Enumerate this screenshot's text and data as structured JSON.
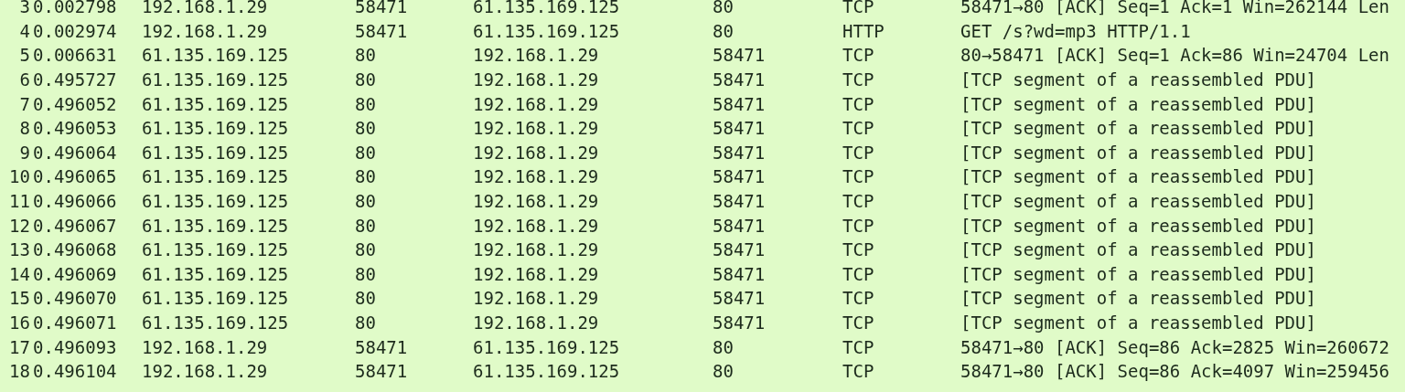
{
  "packet_list": {
    "rows": [
      {
        "no": "3",
        "time": "0.002798",
        "source": "192.168.1.29",
        "src_port": "58471",
        "destination": "61.135.169.125",
        "dst_port": "80",
        "protocol": "TCP",
        "info": "58471→80 [ACK] Seq=1 Ack=1 Win=262144 Len"
      },
      {
        "no": "4",
        "time": "0.002974",
        "source": "192.168.1.29",
        "src_port": "58471",
        "destination": "61.135.169.125",
        "dst_port": "80",
        "protocol": "HTTP",
        "info": "GET /s?wd=mp3 HTTP/1.1"
      },
      {
        "no": "5",
        "time": "0.006631",
        "source": "61.135.169.125",
        "src_port": "80",
        "destination": "192.168.1.29",
        "dst_port": "58471",
        "protocol": "TCP",
        "info": "80→58471 [ACK] Seq=1 Ack=86 Win=24704 Len"
      },
      {
        "no": "6",
        "time": "0.495727",
        "source": "61.135.169.125",
        "src_port": "80",
        "destination": "192.168.1.29",
        "dst_port": "58471",
        "protocol": "TCP",
        "info": "[TCP segment of a reassembled PDU]"
      },
      {
        "no": "7",
        "time": "0.496052",
        "source": "61.135.169.125",
        "src_port": "80",
        "destination": "192.168.1.29",
        "dst_port": "58471",
        "protocol": "TCP",
        "info": "[TCP segment of a reassembled PDU]"
      },
      {
        "no": "8",
        "time": "0.496053",
        "source": "61.135.169.125",
        "src_port": "80",
        "destination": "192.168.1.29",
        "dst_port": "58471",
        "protocol": "TCP",
        "info": "[TCP segment of a reassembled PDU]"
      },
      {
        "no": "9",
        "time": "0.496064",
        "source": "61.135.169.125",
        "src_port": "80",
        "destination": "192.168.1.29",
        "dst_port": "58471",
        "protocol": "TCP",
        "info": "[TCP segment of a reassembled PDU]"
      },
      {
        "no": "10",
        "time": "0.496065",
        "source": "61.135.169.125",
        "src_port": "80",
        "destination": "192.168.1.29",
        "dst_port": "58471",
        "protocol": "TCP",
        "info": "[TCP segment of a reassembled PDU]"
      },
      {
        "no": "11",
        "time": "0.496066",
        "source": "61.135.169.125",
        "src_port": "80",
        "destination": "192.168.1.29",
        "dst_port": "58471",
        "protocol": "TCP",
        "info": "[TCP segment of a reassembled PDU]"
      },
      {
        "no": "12",
        "time": "0.496067",
        "source": "61.135.169.125",
        "src_port": "80",
        "destination": "192.168.1.29",
        "dst_port": "58471",
        "protocol": "TCP",
        "info": "[TCP segment of a reassembled PDU]"
      },
      {
        "no": "13",
        "time": "0.496068",
        "source": "61.135.169.125",
        "src_port": "80",
        "destination": "192.168.1.29",
        "dst_port": "58471",
        "protocol": "TCP",
        "info": "[TCP segment of a reassembled PDU]"
      },
      {
        "no": "14",
        "time": "0.496069",
        "source": "61.135.169.125",
        "src_port": "80",
        "destination": "192.168.1.29",
        "dst_port": "58471",
        "protocol": "TCP",
        "info": "[TCP segment of a reassembled PDU]"
      },
      {
        "no": "15",
        "time": "0.496070",
        "source": "61.135.169.125",
        "src_port": "80",
        "destination": "192.168.1.29",
        "dst_port": "58471",
        "protocol": "TCP",
        "info": "[TCP segment of a reassembled PDU]"
      },
      {
        "no": "16",
        "time": "0.496071",
        "source": "61.135.169.125",
        "src_port": "80",
        "destination": "192.168.1.29",
        "dst_port": "58471",
        "protocol": "TCP",
        "info": "[TCP segment of a reassembled PDU]"
      },
      {
        "no": "17",
        "time": "0.496093",
        "source": "192.168.1.29",
        "src_port": "58471",
        "destination": "61.135.169.125",
        "dst_port": "80",
        "protocol": "TCP",
        "info": "58471→80 [ACK] Seq=86 Ack=2825 Win=260672"
      },
      {
        "no": "18",
        "time": "0.496104",
        "source": "192.168.1.29",
        "src_port": "58471",
        "destination": "61.135.169.125",
        "dst_port": "80",
        "protocol": "TCP",
        "info": "58471→80 [ACK] Seq=86 Ack=4097 Win=259456"
      }
    ]
  }
}
